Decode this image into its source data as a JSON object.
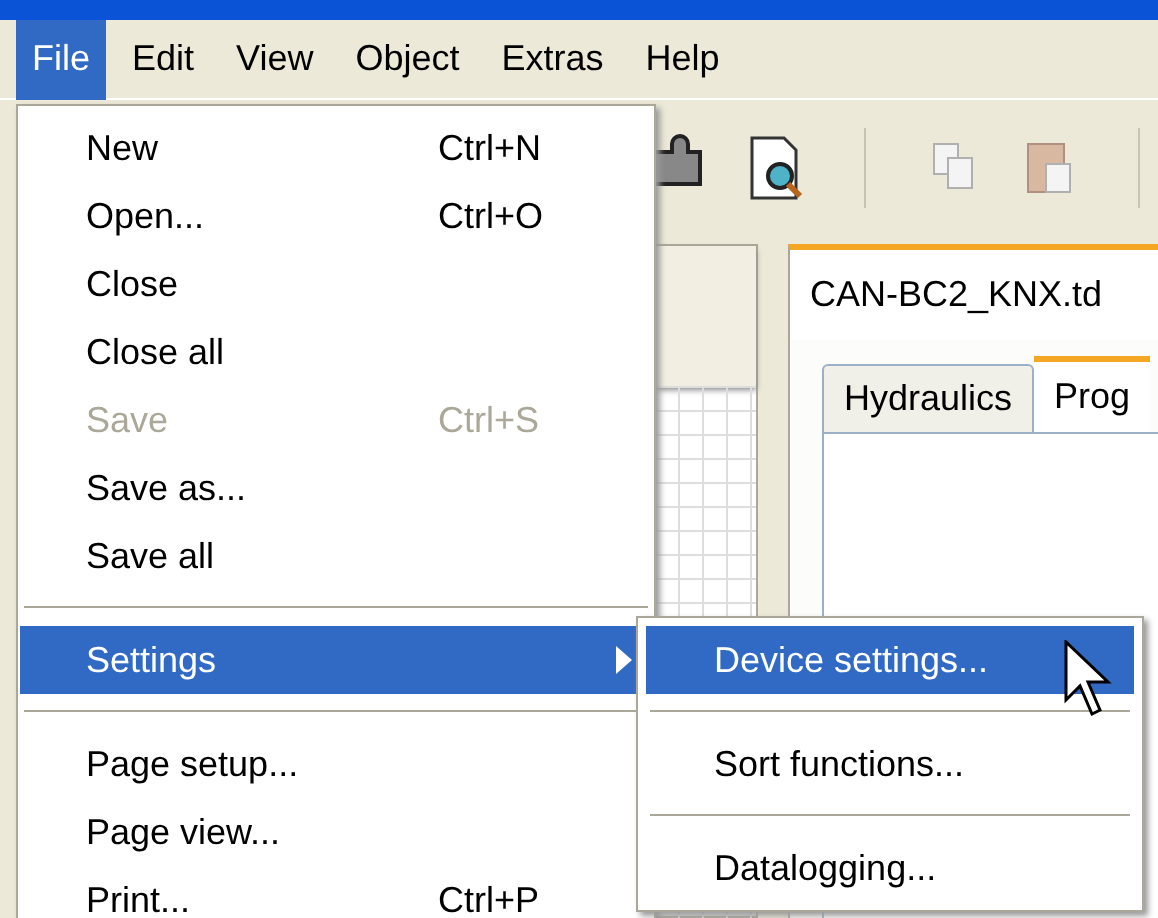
{
  "menubar": [
    {
      "label": "File",
      "selected": true
    },
    {
      "label": "Edit",
      "selected": false
    },
    {
      "label": "View",
      "selected": false
    },
    {
      "label": "Object",
      "selected": false
    },
    {
      "label": "Extras",
      "selected": false
    },
    {
      "label": "Help",
      "selected": false
    }
  ],
  "document": {
    "title": "CAN-BC2_KNX.td",
    "tabs": [
      {
        "label": "Hydraulics",
        "selected": false
      },
      {
        "label": "Prog",
        "selected": true
      }
    ]
  },
  "file_menu": [
    {
      "kind": "item",
      "label": "New",
      "shortcut": "Ctrl+N",
      "disabled": false,
      "selected": false
    },
    {
      "kind": "item",
      "label": "Open...",
      "shortcut": "Ctrl+O",
      "disabled": false,
      "selected": false
    },
    {
      "kind": "item",
      "label": "Close",
      "disabled": false,
      "selected": false
    },
    {
      "kind": "item",
      "label": "Close all",
      "disabled": false,
      "selected": false
    },
    {
      "kind": "item",
      "label": "Save",
      "shortcut": "Ctrl+S",
      "disabled": true,
      "selected": false
    },
    {
      "kind": "item",
      "label": "Save as...",
      "disabled": false,
      "selected": false
    },
    {
      "kind": "item",
      "label": "Save all",
      "disabled": false,
      "selected": false
    },
    {
      "kind": "separator"
    },
    {
      "kind": "submenu",
      "label": "Settings",
      "disabled": false,
      "selected": true
    },
    {
      "kind": "separator"
    },
    {
      "kind": "item",
      "label": "Page setup...",
      "disabled": false,
      "selected": false
    },
    {
      "kind": "item",
      "label": "Page view...",
      "disabled": false,
      "selected": false
    },
    {
      "kind": "item",
      "label": "Print...",
      "shortcut": "Ctrl+P",
      "disabled": false,
      "selected": false
    }
  ],
  "settings_submenu": [
    {
      "kind": "item",
      "label": "Device settings...",
      "selected": true
    },
    {
      "kind": "separator"
    },
    {
      "kind": "item",
      "label": "Sort functions...",
      "selected": false
    },
    {
      "kind": "separator"
    },
    {
      "kind": "item",
      "label": "Datalogging...",
      "selected": false
    }
  ]
}
